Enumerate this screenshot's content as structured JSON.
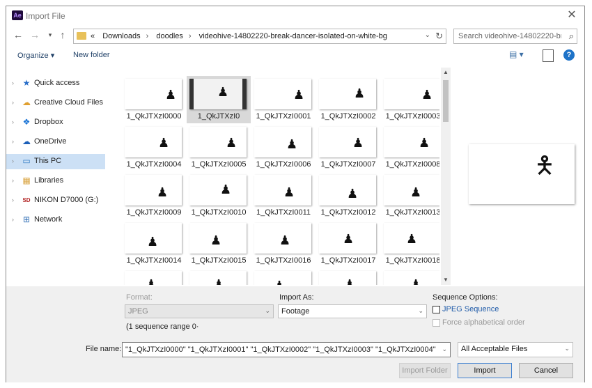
{
  "window": {
    "app_icon": "Ae",
    "title": "Import File",
    "close_glyph": "✕"
  },
  "address": {
    "crumbs": [
      "«",
      "Downloads",
      "doodles",
      "videohive-14802220-break-dancer-isolated-on-white-bg"
    ],
    "search_placeholder": "Search videohive-14802220-br..."
  },
  "toolbar": {
    "organize": "Organize ▾",
    "new_folder": "New folder",
    "help": "?"
  },
  "sidebar": {
    "items": [
      {
        "label": "Quick access",
        "icon": "star-icon",
        "glyph": "★",
        "color": "#2a6fc9",
        "selected": false
      },
      {
        "label": "Creative Cloud Files",
        "icon": "creative-cloud-icon",
        "glyph": "☁",
        "color": "#e0a030",
        "selected": false
      },
      {
        "label": "Dropbox",
        "icon": "dropbox-icon",
        "glyph": "❖",
        "color": "#1a74d6",
        "selected": false
      },
      {
        "label": "OneDrive",
        "icon": "onedrive-icon",
        "glyph": "☁",
        "color": "#1b5fb8",
        "selected": false
      },
      {
        "label": "This PC",
        "icon": "computer-icon",
        "glyph": "▭",
        "color": "#3b82c8",
        "selected": true
      },
      {
        "label": "Libraries",
        "icon": "libraries-icon",
        "glyph": "▦",
        "color": "#d9a441",
        "selected": false
      },
      {
        "label": "NIKON D7000 (G:)",
        "icon": "sd-card-icon",
        "glyph": "SD",
        "color": "#b22222",
        "selected": false
      },
      {
        "label": "Network",
        "icon": "network-icon",
        "glyph": "⊞",
        "color": "#2f6db5",
        "selected": false
      }
    ]
  },
  "files": {
    "items": [
      {
        "name": "1_QkJTXzI0000",
        "glyph": "🯅"
      },
      {
        "name": "1_QkJTXzI0",
        "glyph": "🯇"
      },
      {
        "name": "1_QkJTXzI0001",
        "glyph": "🯅"
      },
      {
        "name": "1_QkJTXzI0002",
        "glyph": "🯆"
      },
      {
        "name": "1_QkJTXzI0003",
        "glyph": "🯅"
      },
      {
        "name": "1_QkJTXzI0004",
        "glyph": "🯅"
      },
      {
        "name": "1_QkJTXzI0005",
        "glyph": "🯅"
      },
      {
        "name": "1_QkJTXzI0006",
        "glyph": "🯆"
      },
      {
        "name": "1_QkJTXzI0007",
        "glyph": "🯅"
      },
      {
        "name": "1_QkJTXzI0008",
        "glyph": "🯆"
      },
      {
        "name": "1_QkJTXzI0009",
        "glyph": "🯅"
      },
      {
        "name": "1_QkJTXzI0010",
        "glyph": "🯅"
      },
      {
        "name": "1_QkJTXzI0011",
        "glyph": "🯈"
      },
      {
        "name": "1_QkJTXzI0012",
        "glyph": "🯈"
      },
      {
        "name": "1_QkJTXzI0013",
        "glyph": "🯇"
      },
      {
        "name": "1_QkJTXzI0014",
        "glyph": "🯉"
      },
      {
        "name": "1_QkJTXzI0015",
        "glyph": "🯉"
      },
      {
        "name": "1_QkJTXzI0016",
        "glyph": "🯉"
      },
      {
        "name": "1_QkJTXzI0017",
        "glyph": "🯉"
      },
      {
        "name": "1_QkJTXzI0018",
        "glyph": "🯉"
      },
      {
        "name": "",
        "glyph": "🯉"
      },
      {
        "name": "",
        "glyph": "🯉"
      },
      {
        "name": "",
        "glyph": "🯉"
      },
      {
        "name": "",
        "glyph": "🯉"
      },
      {
        "name": "",
        "glyph": "🯉"
      }
    ],
    "selected_index": 1
  },
  "options": {
    "format_label": "Format:",
    "format_value": "JPEG",
    "sequence_range": "(1 sequence range 0·",
    "import_as_label": "Import As:",
    "import_as_value": "Footage",
    "sequence_options_label": "Sequence Options:",
    "jpeg_sequence": "JPEG Sequence",
    "force_alpha": "Force alphabetical order"
  },
  "bottom": {
    "file_name_label": "File name:",
    "file_name_value": "\"1_QkJTXzI0000\" \"1_QkJTXzI0001\" \"1_QkJTXzI0002\" \"1_QkJTXzI0003\" \"1_QkJTXzI0004\" \"1_QkJTXzI00",
    "file_type": "All Acceptable Files",
    "import_folder": "Import Folder",
    "import": "Import",
    "cancel": "Cancel"
  }
}
